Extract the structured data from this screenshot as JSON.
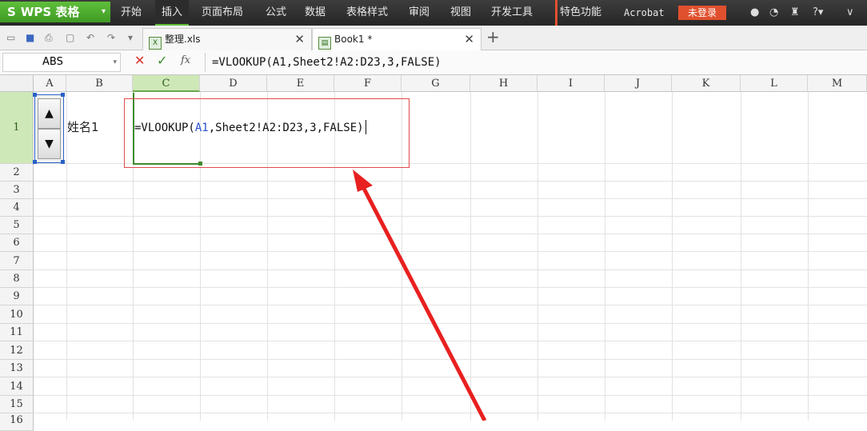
{
  "app": {
    "logo_letter": "S",
    "logo_name": "WPS 表格"
  },
  "menu": [
    {
      "label": "开始"
    },
    {
      "label": "插入"
    },
    {
      "label": "页面布局"
    },
    {
      "label": "公式"
    },
    {
      "label": "数据"
    },
    {
      "label": "表格样式"
    },
    {
      "label": "审阅"
    },
    {
      "label": "视图"
    },
    {
      "label": "开发工具"
    },
    {
      "label": "特色功能"
    },
    {
      "label": "Acrobat"
    }
  ],
  "active_menu": "插入",
  "login_button": "未登录",
  "tabs": [
    {
      "label": "整理.xls"
    },
    {
      "label": "Book1 *"
    }
  ],
  "name_box": "ABS",
  "formula": "=VLOOKUP(A1,Sheet2!A2:D23,3,FALSE)",
  "columns": [
    "A",
    "B",
    "C",
    "D",
    "E",
    "F",
    "G",
    "H",
    "I",
    "J",
    "K",
    "L",
    "M"
  ],
  "selected_column": "C",
  "rows": [
    "1",
    "2",
    "3",
    "4",
    "5",
    "6",
    "7",
    "8",
    "9",
    "10",
    "11",
    "12",
    "13",
    "14",
    "15",
    "16"
  ],
  "cells": {
    "B1": "姓名1",
    "C1": {
      "prefix": "=VLOOKUP(",
      "ref": "A1",
      "suffix": ",Sheet2!A2:D23,3,FALSE)"
    }
  },
  "colors": {
    "accent_green": "#5fbf3a",
    "annotation_red": "#e82020",
    "login_red": "#e0502e",
    "ref_blue": "#2a4fd1"
  }
}
